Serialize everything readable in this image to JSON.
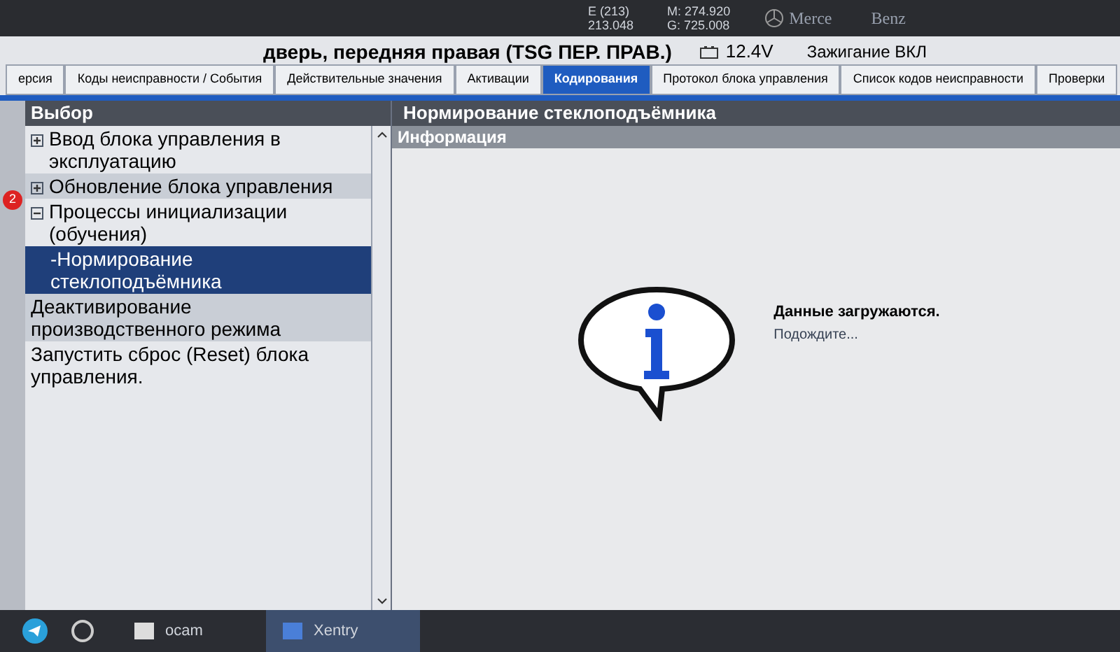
{
  "header": {
    "readouts": [
      "E (213)",
      "213.048",
      "M: 274.920",
      "G: 725.008"
    ],
    "brand": [
      "Merce",
      "Benz"
    ]
  },
  "title_bar": {
    "title": "дверь, передняя правая (TSG ПЕР. ПРАВ.)",
    "battery": "12.4V",
    "ignition": "Зажигание ВКЛ"
  },
  "tabs": [
    {
      "label": "ерсия",
      "selected": false
    },
    {
      "label": "Коды неисправности / События",
      "selected": false
    },
    {
      "label": "Действительные значения",
      "selected": false
    },
    {
      "label": "Активации",
      "selected": false
    },
    {
      "label": "Кодирования",
      "selected": true
    },
    {
      "label": "Протокол блока управления",
      "selected": false
    },
    {
      "label": "Список кодов неисправности",
      "selected": false
    },
    {
      "label": "Проверки",
      "selected": false
    }
  ],
  "sidebar": {
    "title": "Выбор",
    "badge": "2",
    "items": [
      {
        "label": "Ввод блока управления в эксплуатацию",
        "kind": "group",
        "expanded": false,
        "selected": false
      },
      {
        "label": "Обновление блока управления",
        "kind": "group",
        "expanded": false,
        "selected": false
      },
      {
        "label": "Процессы инициализации (обучения)",
        "kind": "group",
        "expanded": true,
        "selected": false,
        "children": [
          {
            "label": "-Нормирование стеклоподъёмника",
            "kind": "leaf",
            "selected": true
          }
        ]
      },
      {
        "label": "Деактивирование производственного режима",
        "kind": "leaf",
        "selected": false
      },
      {
        "label": "Запустить сброс (Reset) блока управления.",
        "kind": "leaf",
        "selected": false
      }
    ]
  },
  "content": {
    "title": "Нормирование стеклоподъёмника",
    "section": "Информация",
    "message": "Данные загружаются.",
    "hint": "Подождите..."
  },
  "taskbar": {
    "items": [
      {
        "label": "ocam",
        "selected": false
      },
      {
        "label": "Xentry",
        "selected": true
      }
    ]
  }
}
